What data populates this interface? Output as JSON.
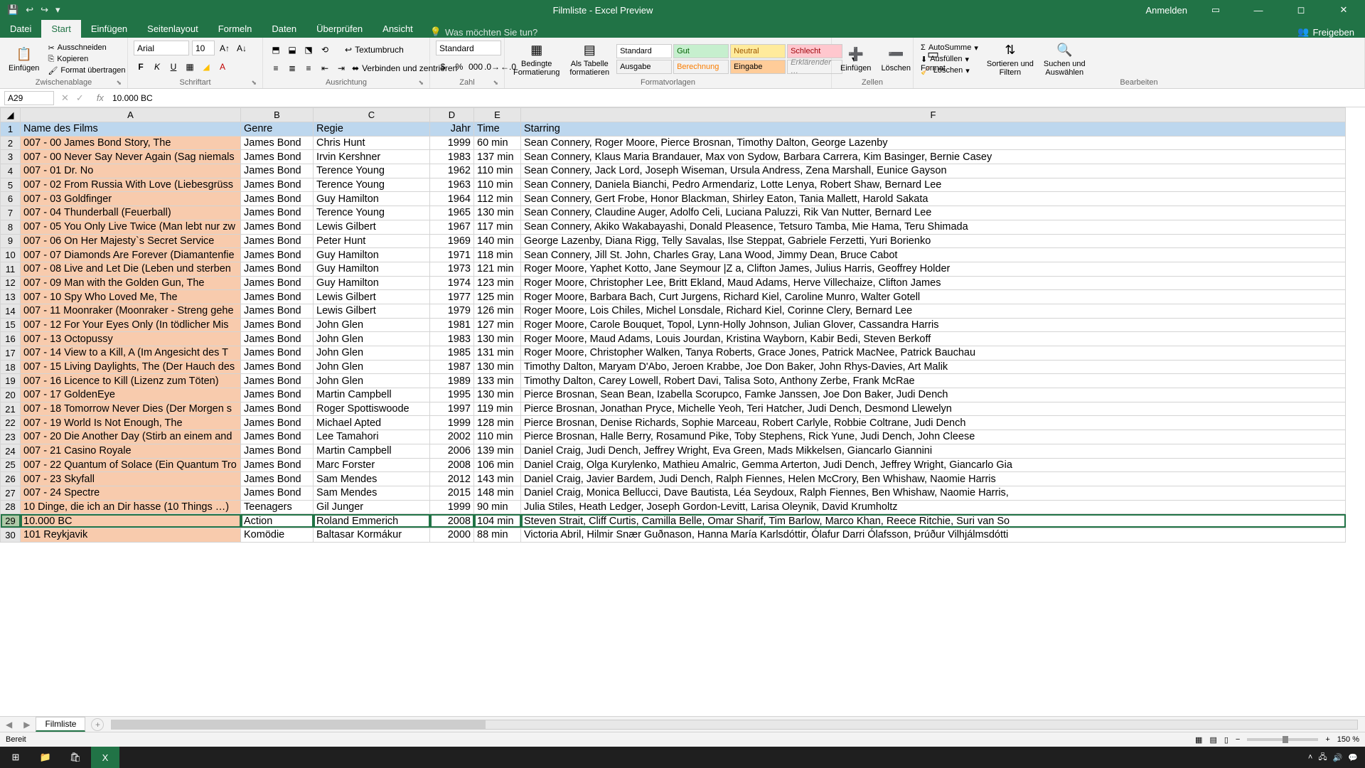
{
  "title": "Filmliste  -  Excel Preview",
  "titlebar": {
    "signin": "Anmelden"
  },
  "tabs": {
    "file": "Datei",
    "home": "Start",
    "insert": "Einfügen",
    "pagelayout": "Seitenlayout",
    "formulas": "Formeln",
    "data": "Daten",
    "review": "Überprüfen",
    "view": "Ansicht",
    "tell": "Was möchten Sie tun?",
    "share": "Freigeben"
  },
  "ribbon": {
    "clipboard": {
      "paste": "Einfügen",
      "cut": "Ausschneiden",
      "copy": "Kopieren",
      "formatpainter": "Format übertragen",
      "label": "Zwischenablage"
    },
    "font": {
      "name": "Arial",
      "size": "10",
      "label": "Schriftart"
    },
    "align": {
      "wrap": "Textumbruch",
      "merge": "Verbinden und zentrieren",
      "label": "Ausrichtung"
    },
    "number": {
      "format": "Standard",
      "label": "Zahl"
    },
    "styles": {
      "cond": "Bedingte\nFormatierung",
      "table": "Als Tabelle\nformatieren",
      "s1": "Standard",
      "s2": "Gut",
      "s3": "Neutral",
      "s4": "Schlecht",
      "s5": "Ausgabe",
      "s6": "Berechnung",
      "s7": "Eingabe",
      "s8": "Erklärender …",
      "label": "Formatvorlagen"
    },
    "cells": {
      "insert": "Einfügen",
      "delete": "Löschen",
      "format": "Format",
      "label": "Zellen"
    },
    "editing": {
      "autosum": "AutoSumme",
      "fill": "Ausfüllen",
      "clear": "Löschen",
      "sort": "Sortieren und\nFiltern",
      "find": "Suchen und\nAuswählen",
      "label": "Bearbeiten"
    }
  },
  "fbar": {
    "cell": "A29",
    "formula": "10.000 BC"
  },
  "columns": [
    "A",
    "B",
    "C",
    "D",
    "E",
    "F"
  ],
  "header": {
    "a": "Name des Films",
    "b": "Genre",
    "c": "Regie",
    "d": "Jahr",
    "e": "Time",
    "f": "Starring"
  },
  "rows": [
    {
      "n": 2,
      "a": "007 - 00 James Bond Story, The",
      "b": "James Bond",
      "c": "Chris Hunt",
      "d": "1999",
      "e": "60 min",
      "f": "Sean Connery, Roger Moore, Pierce Brosnan, Timothy Dalton, George Lazenby"
    },
    {
      "n": 3,
      "a": "007 - 00 Never Say Never Again (Sag niemals",
      "b": "James Bond",
      "c": "Irvin Kershner",
      "d": "1983",
      "e": "137 min",
      "f": "Sean Connery, Klaus Maria Brandauer, Max von Sydow, Barbara Carrera, Kim Basinger, Bernie Casey"
    },
    {
      "n": 4,
      "a": "007 - 01 Dr. No",
      "b": "James Bond",
      "c": "Terence Young",
      "d": "1962",
      "e": "110 min",
      "f": "Sean Connery, Jack Lord, Joseph Wiseman, Ursula Andress, Zena Marshall, Eunice Gayson"
    },
    {
      "n": 5,
      "a": "007 - 02 From Russia With Love (Liebesgrüss",
      "b": "James Bond",
      "c": "Terence Young",
      "d": "1963",
      "e": "110 min",
      "f": "Sean Connery, Daniela Bianchi, Pedro Armendariz, Lotte Lenya, Robert Shaw, Bernard Lee"
    },
    {
      "n": 6,
      "a": "007 - 03 Goldfinger",
      "b": "James Bond",
      "c": "Guy Hamilton",
      "d": "1964",
      "e": "112 min",
      "f": "Sean Connery, Gert Frobe, Honor Blackman, Shirley Eaton, Tania Mallett, Harold Sakata"
    },
    {
      "n": 7,
      "a": "007 - 04 Thunderball (Feuerball)",
      "b": "James Bond",
      "c": "Terence Young",
      "d": "1965",
      "e": "130 min",
      "f": "Sean Connery, Claudine Auger, Adolfo Celi, Luciana Paluzzi, Rik Van Nutter, Bernard Lee"
    },
    {
      "n": 8,
      "a": "007 - 05 You Only Live Twice (Man lebt nur zw",
      "b": "James Bond",
      "c": "Lewis Gilbert",
      "d": "1967",
      "e": "117 min",
      "f": "Sean Connery, Akiko Wakabayashi, Donald Pleasence, Tetsuro Tamba, Mie Hama, Teru Shimada"
    },
    {
      "n": 9,
      "a": "007 - 06 On Her Majesty`s Secret Service",
      "b": "James Bond",
      "c": "Peter Hunt",
      "d": "1969",
      "e": "140 min",
      "f": "George Lazenby, Diana Rigg, Telly Savalas, Ilse Steppat, Gabriele Ferzetti, Yuri Borienko"
    },
    {
      "n": 10,
      "a": "007 - 07 Diamonds Are Forever (Diamantenfie",
      "b": "James Bond",
      "c": "Guy Hamilton",
      "d": "1971",
      "e": "118 min",
      "f": "Sean Connery, Jill St. John, Charles Gray, Lana Wood, Jimmy Dean, Bruce Cabot"
    },
    {
      "n": 11,
      "a": "007 - 08 Live and Let Die (Leben und sterben",
      "b": "James Bond",
      "c": "Guy Hamilton",
      "d": "1973",
      "e": "121 min",
      "f": "Roger Moore, Yaphet Kotto, Jane Seymour |Z a, Clifton James, Julius Harris, Geoffrey Holder"
    },
    {
      "n": 12,
      "a": "007 - 09 Man with the Golden Gun, The",
      "b": "James Bond",
      "c": "Guy Hamilton",
      "d": "1974",
      "e": "123 min",
      "f": "Roger Moore, Christopher Lee, Britt Ekland, Maud Adams, Herve Villechaize, Clifton James"
    },
    {
      "n": 13,
      "a": "007 - 10 Spy Who Loved Me, The",
      "b": "James Bond",
      "c": "Lewis Gilbert",
      "d": "1977",
      "e": "125 min",
      "f": "Roger Moore, Barbara Bach, Curt Jurgens, Richard Kiel, Caroline Munro, Walter Gotell"
    },
    {
      "n": 14,
      "a": "007 - 11 Moonraker (Moonraker - Streng gehe",
      "b": "James Bond",
      "c": "Lewis Gilbert",
      "d": "1979",
      "e": "126 min",
      "f": "Roger Moore, Lois Chiles, Michel Lonsdale, Richard Kiel, Corinne Clery, Bernard Lee"
    },
    {
      "n": 15,
      "a": "007 - 12 For Your Eyes Only (In tödlicher Mis",
      "b": "James Bond",
      "c": "John Glen",
      "d": "1981",
      "e": "127 min",
      "f": "Roger Moore, Carole Bouquet, Topol, Lynn-Holly Johnson, Julian Glover, Cassandra Harris"
    },
    {
      "n": 16,
      "a": "007 - 13 Octopussy",
      "b": "James Bond",
      "c": "John Glen",
      "d": "1983",
      "e": "130 min",
      "f": "Roger Moore, Maud Adams, Louis Jourdan, Kristina Wayborn, Kabir Bedi, Steven Berkoff"
    },
    {
      "n": 17,
      "a": "007 - 14 View to a Kill, A (Im Angesicht des T",
      "b": "James Bond",
      "c": "John Glen",
      "d": "1985",
      "e": "131 min",
      "f": "Roger Moore, Christopher Walken, Tanya Roberts, Grace Jones, Patrick MacNee, Patrick Bauchau"
    },
    {
      "n": 18,
      "a": "007 - 15 Living Daylights, The (Der Hauch des",
      "b": "James Bond",
      "c": "John Glen",
      "d": "1987",
      "e": "130 min",
      "f": "Timothy Dalton, Maryam D'Abo, Jeroen Krabbe, Joe Don Baker, John Rhys-Davies, Art Malik"
    },
    {
      "n": 19,
      "a": "007 - 16 Licence to Kill (Lizenz zum Töten)",
      "b": "James Bond",
      "c": "John Glen",
      "d": "1989",
      "e": "133 min",
      "f": "Timothy Dalton, Carey Lowell, Robert Davi, Talisa Soto, Anthony Zerbe, Frank McRae"
    },
    {
      "n": 20,
      "a": "007 - 17 GoldenEye",
      "b": "James Bond",
      "c": "Martin Campbell",
      "d": "1995",
      "e": "130 min",
      "f": "Pierce Brosnan, Sean Bean, Izabella Scorupco, Famke Janssen, Joe Don Baker, Judi Dench"
    },
    {
      "n": 21,
      "a": "007 - 18 Tomorrow Never Dies (Der Morgen s",
      "b": "James Bond",
      "c": "Roger Spottiswoode",
      "d": "1997",
      "e": "119 min",
      "f": "Pierce Brosnan, Jonathan Pryce, Michelle Yeoh, Teri Hatcher, Judi Dench, Desmond Llewelyn"
    },
    {
      "n": 22,
      "a": "007 - 19 World Is Not Enough, The",
      "b": "James Bond",
      "c": "Michael Apted",
      "d": "1999",
      "e": "128 min",
      "f": "Pierce Brosnan, Denise Richards, Sophie Marceau, Robert Carlyle, Robbie Coltrane, Judi Dench"
    },
    {
      "n": 23,
      "a": "007 - 20 Die Another Day (Stirb an einem and",
      "b": "James Bond",
      "c": "Lee Tamahori",
      "d": "2002",
      "e": "110 min",
      "f": "Pierce Brosnan, Halle Berry, Rosamund Pike, Toby Stephens, Rick Yune, Judi Dench, John Cleese"
    },
    {
      "n": 24,
      "a": "007 - 21 Casino Royale",
      "b": "James Bond",
      "c": "Martin Campbell",
      "d": "2006",
      "e": "139 min",
      "f": "Daniel Craig, Judi Dench, Jeffrey Wright, Eva Green, Mads Mikkelsen, Giancarlo Giannini"
    },
    {
      "n": 25,
      "a": "007 - 22 Quantum of Solace (Ein Quantum Tro",
      "b": "James Bond",
      "c": "Marc Forster",
      "d": "2008",
      "e": "106 min",
      "f": "Daniel Craig, Olga Kurylenko, Mathieu Amalric, Gemma Arterton, Judi Dench, Jeffrey Wright, Giancarlo Gia"
    },
    {
      "n": 26,
      "a": "007 - 23 Skyfall",
      "b": "James Bond",
      "c": "Sam Mendes",
      "d": "2012",
      "e": "143 min",
      "f": "Daniel Craig, Javier Bardem, Judi Dench, Ralph Fiennes, Helen McCrory, Ben Whishaw, Naomie Harris"
    },
    {
      "n": 27,
      "a": "007 - 24 Spectre",
      "b": "James Bond",
      "c": "Sam Mendes",
      "d": "2015",
      "e": "148 min",
      "f": "Daniel Craig, Monica Bellucci, Dave Bautista, Léa Seydoux, Ralph Fiennes, Ben Whishaw, Naomie Harris,"
    },
    {
      "n": 28,
      "a": "10 Dinge, die ich an Dir hasse (10 Things …)",
      "b": "Teenagers",
      "c": "Gil Junger",
      "d": "1999",
      "e": "90 min",
      "f": "Julia Stiles, Heath Ledger, Joseph Gordon-Levitt, Larisa Oleynik, David Krumholtz"
    },
    {
      "n": 29,
      "a": "10.000 BC",
      "b": "Action",
      "c": "Roland Emmerich",
      "d": "2008",
      "e": "104 min",
      "f": "Steven Strait, Cliff Curtis, Camilla Belle, Omar Sharif, Tim Barlow, Marco Khan, Reece Ritchie, Suri van So"
    },
    {
      "n": 30,
      "a": "101 Reykjavik",
      "b": "Komödie",
      "c": "Baltasar Kormákur",
      "d": "2000",
      "e": "88 min",
      "f": "Victoria Abril, Hilmir Snær Guðnason, Hanna María Karlsdóttir, Ólafur Darri Ólafsson, Þrúður Vilhjálmsdótti"
    }
  ],
  "selected_row": 29,
  "sheet": {
    "name": "Filmliste"
  },
  "status": {
    "ready": "Bereit",
    "zoom": "150 %"
  }
}
